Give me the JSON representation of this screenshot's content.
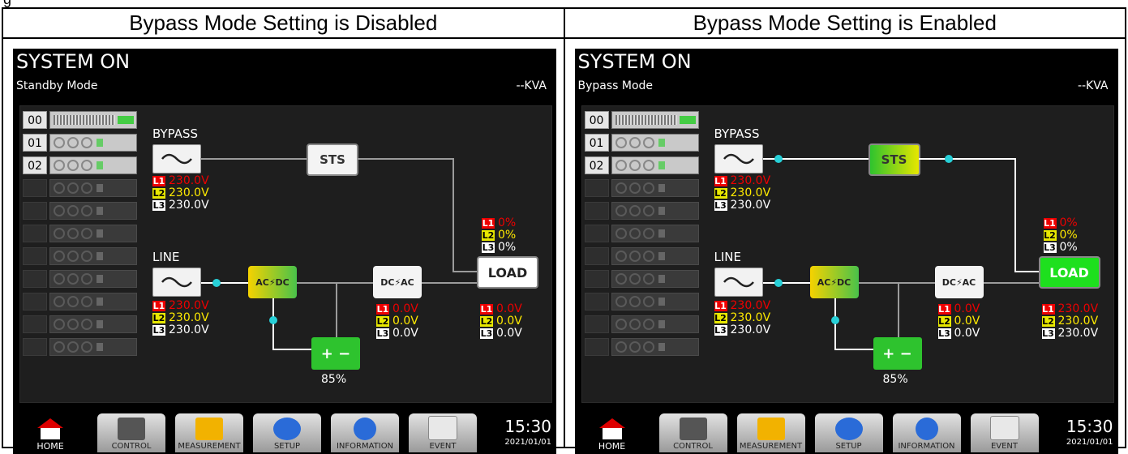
{
  "header_left": "Bypass Mode Setting is Disabled",
  "header_right": "Bypass Mode Setting is Enabled",
  "common": {
    "system_status": "SYSTEM ON",
    "kva": "--KVA",
    "rack_ids": [
      "00",
      "01",
      "02"
    ],
    "bypass_label": "BYPASS",
    "line_label": "LINE",
    "sts_label": "STS",
    "load_label": "LOAD",
    "acdc_label": "AC⚡DC",
    "dcac_label": "DC⚡AC",
    "battery_label": "+ −",
    "battery_pct": "85%",
    "phase_tags": [
      "L1",
      "L2",
      "L3"
    ],
    "time": "15:30",
    "date": "2021/01/01",
    "nav": [
      "HOME",
      "CONTROL",
      "MEASUREMENT",
      "SETUP",
      "INFORMATION",
      "EVENT"
    ]
  },
  "left": {
    "mode": "Standby Mode",
    "bypass_v": [
      "230.0V",
      "230.0V",
      "230.0V"
    ],
    "line_v": [
      "230.0V",
      "230.0V",
      "230.0V"
    ],
    "inverter_v": [
      "0.0V",
      "0.0V",
      "0.0V"
    ],
    "load_pct": [
      "0%",
      "0%",
      "0%"
    ],
    "load_v": [
      "0.0V",
      "0.0V",
      "0.0V"
    ]
  },
  "right": {
    "mode": "Bypass Mode",
    "bypass_v": [
      "230.0V",
      "230.0V",
      "230.0V"
    ],
    "line_v": [
      "230.0V",
      "230.0V",
      "230.0V"
    ],
    "inverter_v": [
      "0.0V",
      "0.0V",
      "0.0V"
    ],
    "load_pct": [
      "0%",
      "0%",
      "0%"
    ],
    "load_v": [
      "230.0V",
      "230.0V",
      "230.0V"
    ]
  },
  "colors": {
    "phase1": "#ee0000",
    "phase2": "#ffea00",
    "phase3": "#ffffff",
    "active_green": "#1ee01e",
    "flow_dot": "#27d0d8"
  }
}
